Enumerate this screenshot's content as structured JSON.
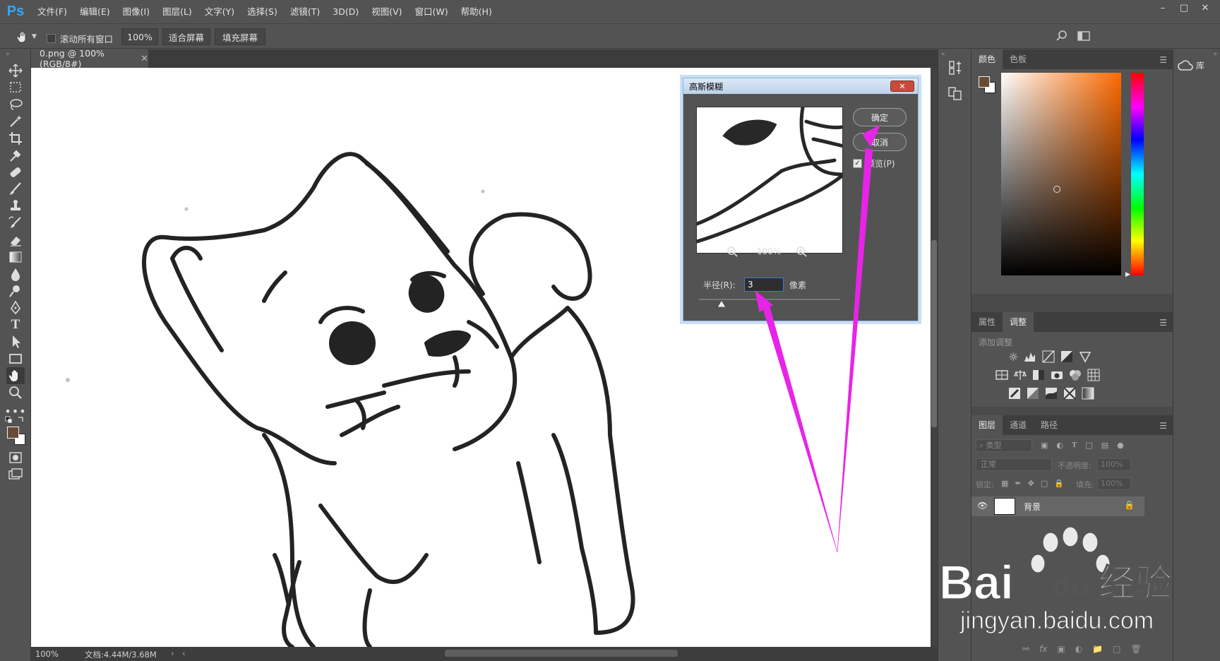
{
  "app": {
    "logo": "Ps"
  },
  "menu": {
    "items": [
      "文件(F)",
      "编辑(E)",
      "图像(I)",
      "图层(L)",
      "文字(Y)",
      "选择(S)",
      "滤镜(T)",
      "3D(D)",
      "视图(V)",
      "窗口(W)",
      "帮助(H)"
    ]
  },
  "options": {
    "scroll_all_label": "滚动所有窗口",
    "zoom_value": "100%",
    "fit_screen": "适合屏幕",
    "fill_screen": "填充屏幕"
  },
  "document": {
    "tab_title": "0.png @ 100%(RGB/8#)",
    "zoom": "100%",
    "doc_info": "文档:4.44M/3.68M"
  },
  "dialog": {
    "title": "高斯模糊",
    "ok": "确定",
    "cancel": "取消",
    "preview_label": "预览(P)",
    "preview_checked": true,
    "preview_zoom": "100%",
    "radius_label": "半径(R):",
    "radius_value": "3",
    "radius_unit": "像素"
  },
  "panels": {
    "color_tabs": [
      "颜色",
      "色板"
    ],
    "adjust_tabs": [
      "属性",
      "调整"
    ],
    "adjust_hint": "添加调整",
    "layer_tabs": [
      "图层",
      "通道",
      "路径"
    ],
    "kind_filter": "类型",
    "blend_mode": "正常",
    "opacity_label": "不透明度:",
    "opacity_value": "100%",
    "lock_label": "锁定:",
    "fill_label": "填充:",
    "fill_value": "100%",
    "layer_name": "背景",
    "foreground_color": "#6b4a35",
    "background_color": "#ffffff",
    "hue_color": "#ff6a00"
  },
  "library": {
    "label": "库"
  },
  "watermark": {
    "text": "Bai",
    "du": "du",
    "cn": "经验",
    "url": "jingyan.baidu.com"
  },
  "colors": {
    "annotation_arrow": "#e824e8",
    "selection_blue": "#3d7bd1"
  }
}
